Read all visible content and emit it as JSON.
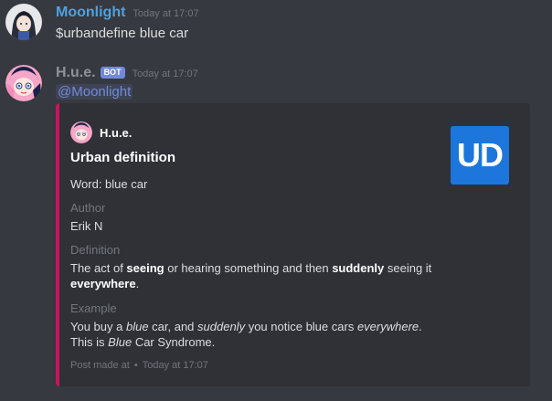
{
  "messages": [
    {
      "username": "Moonlight",
      "username_color": "#4fa1e0",
      "timestamp": "Today at 17:07",
      "content": "$urbandefine blue car"
    },
    {
      "username": "H.u.e.",
      "username_color": "#8e9297",
      "bot_tag": "BOT",
      "timestamp": "Today at 17:07",
      "mention": "@Moonlight"
    }
  ],
  "embed": {
    "accent_color": "#c2185b",
    "author_name": "H.u.e.",
    "title": "Urban definition",
    "description": "Word: blue car",
    "thumbnail_text": "UD",
    "thumbnail_color": "#1d76db",
    "fields": {
      "author": {
        "name": "Author",
        "value": "Erik N"
      },
      "definition": {
        "name": "Definition",
        "segments_line1": [
          "The act of ",
          "seeing",
          " or hearing something and then ",
          "suddenly",
          " seeing it"
        ],
        "segments_line2": [
          "everywhere",
          "."
        ]
      },
      "example": {
        "name": "Example",
        "segments_line1": [
          "You buy a ",
          "blue",
          " car, and ",
          "suddenly",
          " you notice blue cars ",
          "everywhere",
          "."
        ],
        "segments_line2": [
          "This is ",
          "Blue",
          " Car Syndrome."
        ]
      }
    },
    "footer": {
      "text": "Post made at",
      "separator": "•",
      "timestamp": "Today at 17:07"
    }
  }
}
